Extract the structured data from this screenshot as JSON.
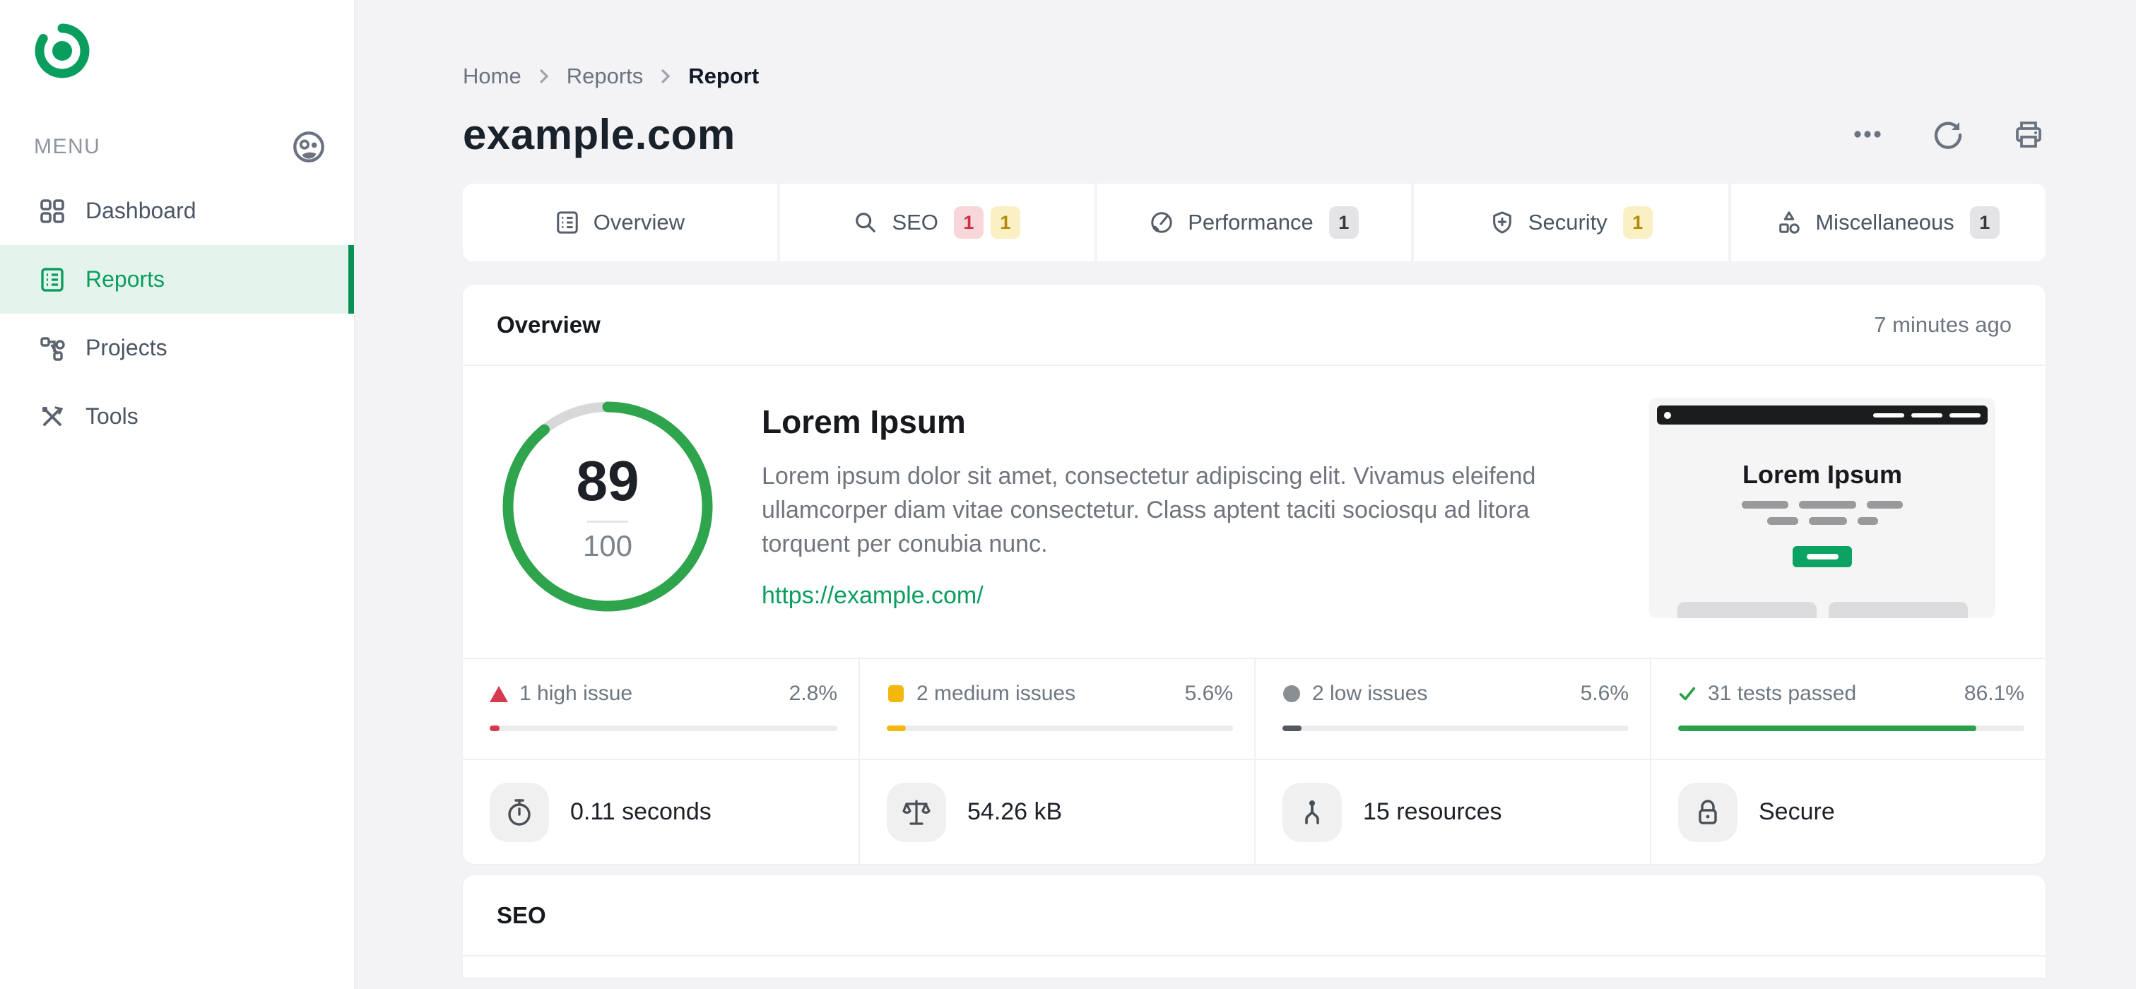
{
  "app": {
    "menu_label": "MENU",
    "logo_icon": "target-logo-icon",
    "menu_action_icon": "persona-icon"
  },
  "sidebar": {
    "items": [
      {
        "label": "Dashboard",
        "icon": "grid-icon",
        "active": false
      },
      {
        "label": "Reports",
        "icon": "report-icon",
        "active": true
      },
      {
        "label": "Projects",
        "icon": "hierarchy-icon",
        "active": false
      },
      {
        "label": "Tools",
        "icon": "tools-icon",
        "active": false
      }
    ]
  },
  "breadcrumb": {
    "items": [
      "Home",
      "Reports",
      "Report"
    ]
  },
  "page": {
    "title": "example.com",
    "actions": [
      "ellipsis-icon",
      "refresh-icon",
      "printer-icon"
    ]
  },
  "tabs": [
    {
      "label": "Overview",
      "icon": "report-icon",
      "badges": []
    },
    {
      "label": "SEO",
      "icon": "search-icon",
      "badges": [
        {
          "text": "1",
          "type": "red"
        },
        {
          "text": "1",
          "type": "yellow"
        }
      ]
    },
    {
      "label": "Performance",
      "icon": "gauge-icon",
      "badges": [
        {
          "text": "1",
          "type": "gray"
        }
      ]
    },
    {
      "label": "Security",
      "icon": "shield-icon",
      "badges": [
        {
          "text": "1",
          "type": "yellow"
        }
      ]
    },
    {
      "label": "Miscellaneous",
      "icon": "shapes-icon",
      "badges": [
        {
          "text": "1",
          "type": "gray"
        }
      ]
    }
  ],
  "overview": {
    "section_title": "Overview",
    "timestamp": "7 minutes ago",
    "score": {
      "value": "89",
      "max": "100",
      "percent": 89
    },
    "site": {
      "heading": "Lorem Ipsum",
      "description": "Lorem ipsum dolor sit amet, consectetur adipiscing elit. Vivamus eleifend ullamcorper diam vitae consectetur. Class aptent taciti sociosqu ad litora torquent per conubia nunc.",
      "url": "https://example.com/"
    },
    "thumbnail": {
      "heading": "Lorem Ipsum"
    },
    "stats": [
      {
        "label": "1 high issue",
        "value": "2.8%",
        "percent": 2.8,
        "type": "high",
        "icon": "triangle-icon"
      },
      {
        "label": "2 medium issues",
        "value": "5.6%",
        "percent": 5.6,
        "type": "medium",
        "icon": "square-icon"
      },
      {
        "label": "2 low issues",
        "value": "5.6%",
        "percent": 5.6,
        "type": "low",
        "icon": "circle-icon"
      },
      {
        "label": "31 tests passed",
        "value": "86.1%",
        "percent": 86.1,
        "type": "passed",
        "icon": "check-icon"
      }
    ],
    "metrics": [
      {
        "label": "0.11 seconds",
        "icon": "stopwatch-icon"
      },
      {
        "label": "54.26 kB",
        "icon": "scale-icon"
      },
      {
        "label": "15 resources",
        "icon": "split-icon"
      },
      {
        "label": "Secure",
        "icon": "lock-icon"
      }
    ]
  },
  "seo_section": {
    "title": "SEO"
  },
  "colors": {
    "brand_green": "#0a9e5e",
    "ring_green": "#2ea44c",
    "ring_track": "#d8d8d8",
    "active_item_bg": "#e4f3ec",
    "page_bg": "#f3f3f5",
    "status_red": "#d63a4f",
    "status_amber": "#f3b70d",
    "status_gray": "#8a8f94",
    "status_green": "#2aa14b",
    "badge_red_bg": "#f7d7da",
    "badge_red_text": "#cc2f44",
    "badge_yellow_bg": "#faf0c4",
    "badge_yellow_text": "#b5890a",
    "badge_gray_bg": "#e4e4e6"
  }
}
